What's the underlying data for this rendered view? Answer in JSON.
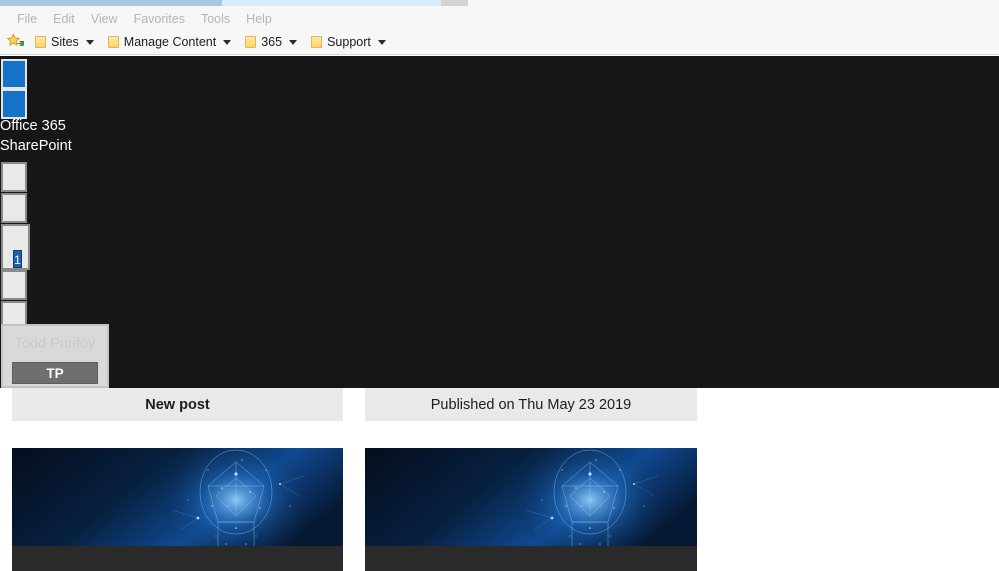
{
  "browser": {
    "tabs": [
      {
        "name": "active-tab",
        "state": "active"
      },
      {
        "name": "inactive-tab",
        "state": "inactive"
      },
      {
        "name": "new-tab-button",
        "state": "button"
      }
    ],
    "menu": {
      "items": [
        "File",
        "Edit",
        "View",
        "Favorites",
        "Tools",
        "Help"
      ]
    },
    "favorites_bar": {
      "add_icon": "star-icon",
      "items": [
        {
          "label": "Sites",
          "icon": "folder-icon",
          "has_caret": true
        },
        {
          "label": "Manage Content",
          "icon": "folder-icon",
          "has_caret": true
        },
        {
          "label": "365",
          "icon": "folder-icon",
          "has_caret": true
        },
        {
          "label": "Support",
          "icon": "folder-icon",
          "has_caret": true
        }
      ]
    }
  },
  "suite_bar": {
    "background": "#161616",
    "app_launcher_icon": "waffle-icon",
    "brand": {
      "suite_name": "Office 365",
      "app_name": "SharePoint"
    },
    "actions": [
      {
        "name": "suite-action-1",
        "label": ""
      },
      {
        "name": "suite-action-2",
        "label": ""
      },
      {
        "name": "notifications",
        "label": "",
        "badge": "1"
      },
      {
        "name": "suite-action-4",
        "label": ""
      },
      {
        "name": "suite-action-5",
        "label": ""
      }
    ],
    "user": {
      "name": "Todd Purifoy",
      "initials": "TP",
      "accent": "#6f6f6f"
    }
  },
  "posts": [
    {
      "title": "New post",
      "emphasis": "bold",
      "hero": {
        "name": "lightbulb-network-image",
        "alt": "Glowing particle network light bulb on dark blue background",
        "colors": {
          "deep": "#061126",
          "mid": "#0d3a7a",
          "glow": "#2f9bff"
        }
      }
    },
    {
      "title": "Published on Thu May 23 2019",
      "emphasis": "normal",
      "hero": {
        "name": "lightbulb-network-image",
        "alt": "Glowing particle network light bulb on dark blue background",
        "colors": {
          "deep": "#061126",
          "mid": "#0d3a7a",
          "glow": "#2f9bff"
        }
      }
    }
  ]
}
